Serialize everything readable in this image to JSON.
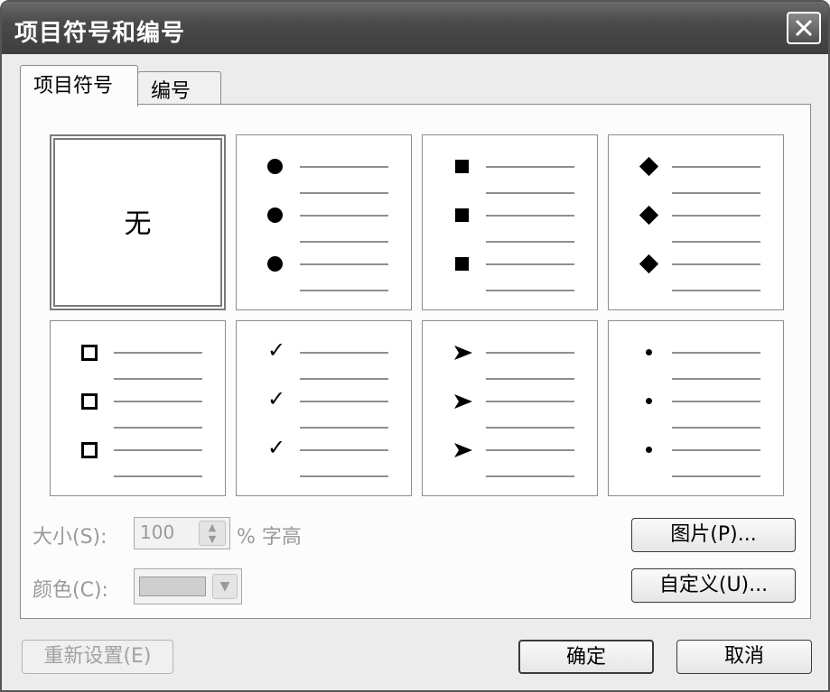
{
  "window": {
    "title": "项目符号和编号",
    "close_icon": "close-icon"
  },
  "tabs": [
    {
      "label": "项目符号",
      "selected": true
    },
    {
      "label": "编号",
      "selected": false
    }
  ],
  "gallery": {
    "none_label": "无",
    "styles": [
      "none",
      "filled-circle",
      "filled-square",
      "filled-diamond",
      "hollow-square",
      "checkmark",
      "arrowhead",
      "small-dot"
    ],
    "selected_index": 0
  },
  "size": {
    "label": "大小(S):",
    "value": "100",
    "unit": "% 字高"
  },
  "color": {
    "label": "颜色(C):"
  },
  "buttons": {
    "picture": "图片(P)...",
    "customize": "自定义(U)...",
    "reset": "重新设置(E)",
    "ok": "确定",
    "cancel": "取消"
  }
}
